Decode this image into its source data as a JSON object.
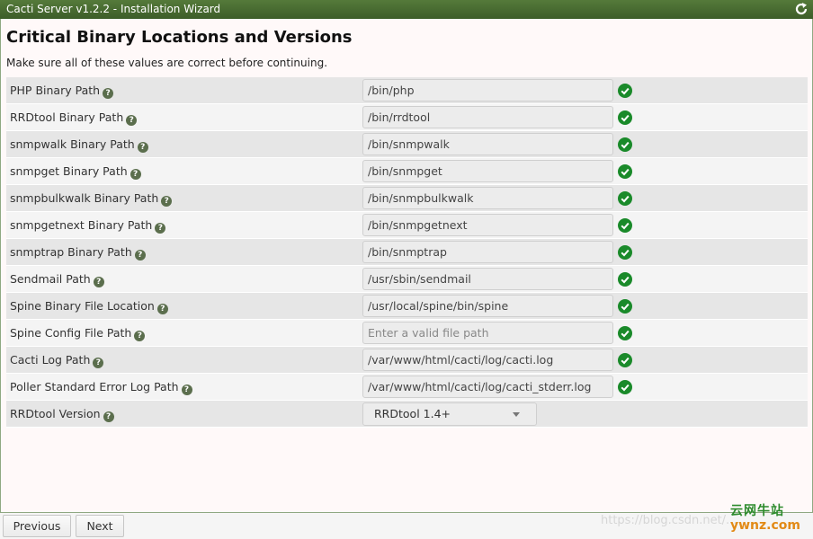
{
  "window": {
    "title": "Cacti Server v1.2.2 - Installation Wizard",
    "refresh_icon": "refresh-icon"
  },
  "page": {
    "title": "Critical Binary Locations and Versions",
    "subtitle": "Make sure all of these values are correct before continuing."
  },
  "fields": [
    {
      "label": "PHP Binary Path",
      "value": "/bin/php",
      "placeholder": "",
      "valid": true
    },
    {
      "label": "RRDtool Binary Path",
      "value": "/bin/rrdtool",
      "placeholder": "",
      "valid": true
    },
    {
      "label": "snmpwalk Binary Path",
      "value": "/bin/snmpwalk",
      "placeholder": "",
      "valid": true
    },
    {
      "label": "snmpget Binary Path",
      "value": "/bin/snmpget",
      "placeholder": "",
      "valid": true
    },
    {
      "label": "snmpbulkwalk Binary Path",
      "value": "/bin/snmpbulkwalk",
      "placeholder": "",
      "valid": true
    },
    {
      "label": "snmpgetnext Binary Path",
      "value": "/bin/snmpgetnext",
      "placeholder": "",
      "valid": true
    },
    {
      "label": "snmptrap Binary Path",
      "value": "/bin/snmptrap",
      "placeholder": "",
      "valid": true
    },
    {
      "label": "Sendmail Path",
      "value": "/usr/sbin/sendmail",
      "placeholder": "",
      "valid": true
    },
    {
      "label": "Spine Binary File Location",
      "value": "/usr/local/spine/bin/spine",
      "placeholder": "",
      "valid": true
    },
    {
      "label": "Spine Config File Path",
      "value": "",
      "placeholder": "Enter a valid file path",
      "valid": true
    },
    {
      "label": "Cacti Log Path",
      "value": "/var/www/html/cacti/log/cacti.log",
      "placeholder": "",
      "valid": true
    },
    {
      "label": "Poller Standard Error Log Path",
      "value": "/var/www/html/cacti/log/cacti_stderr.log",
      "placeholder": "",
      "valid": true
    }
  ],
  "version": {
    "label": "RRDtool Version",
    "selected": "RRDtool 1.4+"
  },
  "footer": {
    "previous_label": "Previous",
    "next_label": "Next"
  },
  "watermark": {
    "url": "https://blog.csdn.net/...",
    "logo_cn": "云网牛站",
    "logo_en": "ywnz.com"
  },
  "colors": {
    "titlebar": "#4a6b34",
    "valid_check": "#1a8a2a",
    "help_icon": "#5b6e4d"
  }
}
